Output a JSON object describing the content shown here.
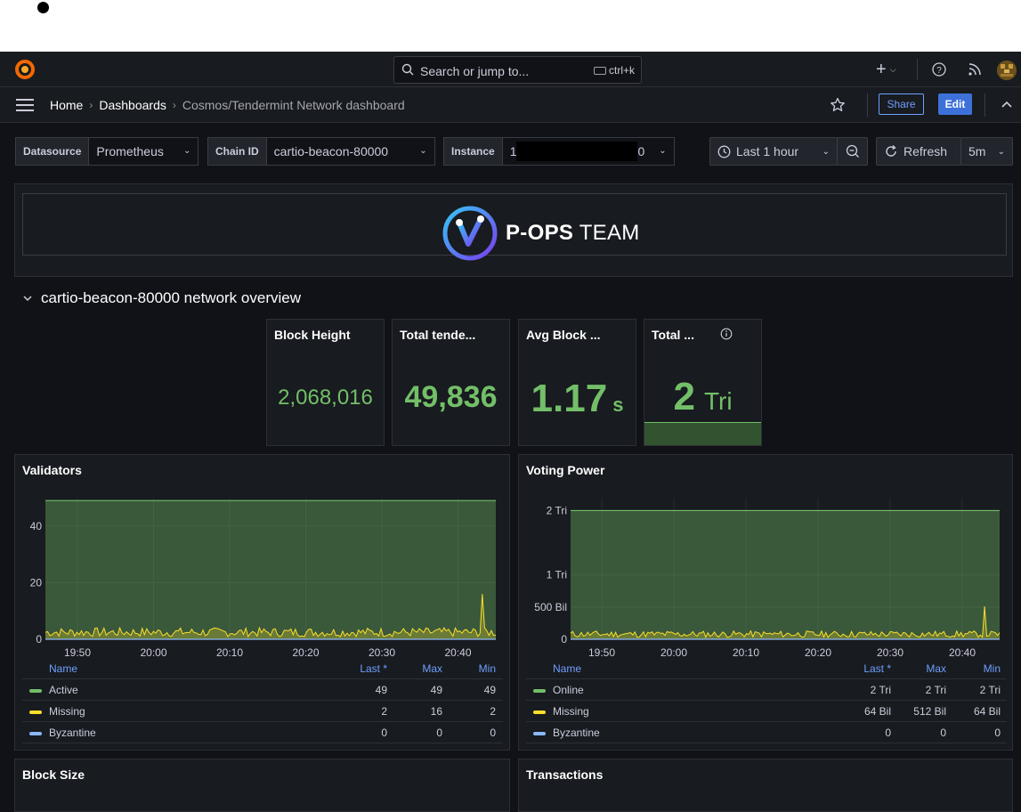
{
  "topbar": {
    "search_placeholder": "Search or jump to...",
    "search_shortcut": "ctrl+k",
    "plus_label": "+"
  },
  "nav": {
    "crumbs": [
      "Home",
      "Dashboards",
      "Cosmos/Tendermint Network dashboard"
    ],
    "share_label": "Share",
    "edit_label": "Edit"
  },
  "variables": {
    "datasource_label": "Datasource",
    "datasource_value": "Prometheus",
    "chain_label": "Chain ID",
    "chain_value": "cartio-beacon-80000",
    "instance_label": "Instance",
    "instance_prefix": "1",
    "instance_suffix": "0"
  },
  "time": {
    "range_label": "Last 1 hour",
    "refresh_label": "Refresh",
    "refresh_interval": "5m"
  },
  "banner": {
    "brand_bold": "P-OPS",
    "brand_rest": " TEAM"
  },
  "row": {
    "title": "cartio-beacon-80000 network overview"
  },
  "stats": [
    {
      "title": "Block Height",
      "value": "2,068,016",
      "unit": ""
    },
    {
      "title": "Total tende...",
      "value": "49,836",
      "unit": ""
    },
    {
      "title": "Avg Block ...",
      "value": "1.17",
      "unit": "s"
    },
    {
      "title": "Total ...",
      "value": "2",
      "unit": "Tri"
    }
  ],
  "validators": {
    "title": "Validators",
    "y_ticks": [
      "40",
      "20",
      "0"
    ],
    "x_ticks": [
      "19:50",
      "20:00",
      "20:10",
      "20:20",
      "20:30",
      "20:40"
    ],
    "legend_headers": [
      "Name",
      "Last *",
      "Max",
      "Min"
    ],
    "rows": [
      {
        "name": "Active",
        "last": "49",
        "max": "49",
        "min": "49"
      },
      {
        "name": "Missing",
        "last": "2",
        "max": "16",
        "min": "2"
      },
      {
        "name": "Byzantine",
        "last": "0",
        "max": "0",
        "min": "0"
      }
    ]
  },
  "voting": {
    "title": "Voting Power",
    "y_ticks": [
      "2 Tri",
      "1 Tri",
      "500 Bil",
      "0"
    ],
    "x_ticks": [
      "19:50",
      "20:00",
      "20:10",
      "20:20",
      "20:30",
      "20:40"
    ],
    "legend_headers": [
      "Name",
      "Last *",
      "Max",
      "Min"
    ],
    "rows": [
      {
        "name": "Online",
        "last": "2 Tri",
        "max": "2 Tri",
        "min": "2 Tri"
      },
      {
        "name": "Missing",
        "last": "64 Bil",
        "max": "512 Bil",
        "min": "64 Bil"
      },
      {
        "name": "Byzantine",
        "last": "0",
        "max": "0",
        "min": "0"
      }
    ]
  },
  "bottom_panels": {
    "block_size_title": "Block Size",
    "transactions_title": "Transactions"
  },
  "colors": {
    "green": "#73bf69",
    "yellow": "#fade2a",
    "blue": "#8ab8ff",
    "accent": "#3d71d9"
  },
  "chart_data": [
    {
      "type": "area",
      "title": "Validators",
      "x": [
        "19:50",
        "20:00",
        "20:10",
        "20:20",
        "20:30",
        "20:40"
      ],
      "ylim": [
        0,
        50
      ],
      "series": [
        {
          "name": "Active",
          "values": [
            49,
            49,
            49,
            49,
            49,
            49
          ]
        },
        {
          "name": "Missing",
          "values": [
            2,
            3,
            2,
            2,
            3,
            2
          ]
        },
        {
          "name": "Byzantine",
          "values": [
            0,
            0,
            0,
            0,
            0,
            0
          ]
        }
      ]
    },
    {
      "type": "area",
      "title": "Voting Power",
      "x": [
        "19:50",
        "20:00",
        "20:10",
        "20:20",
        "20:30",
        "20:40"
      ],
      "ylim": [
        0,
        2200000000000
      ],
      "series": [
        {
          "name": "Online",
          "values": [
            2000000000000,
            2000000000000,
            2000000000000,
            2000000000000,
            2000000000000,
            2000000000000
          ]
        },
        {
          "name": "Missing",
          "values": [
            64000000000,
            90000000000,
            64000000000,
            64000000000,
            80000000000,
            64000000000
          ]
        },
        {
          "name": "Byzantine",
          "values": [
            0,
            0,
            0,
            0,
            0,
            0
          ]
        }
      ]
    }
  ]
}
